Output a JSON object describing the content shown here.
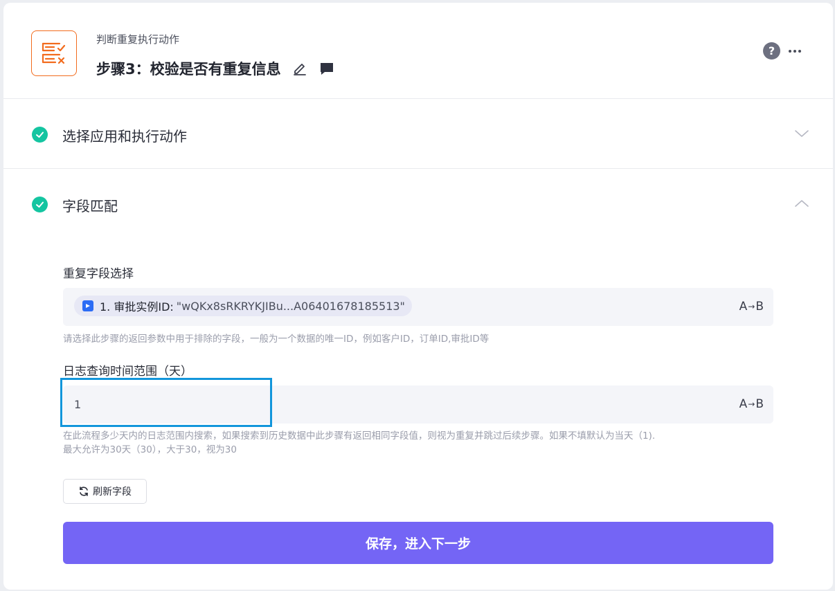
{
  "header": {
    "app_icon": "checklist-x-icon",
    "subtitle": "判断重复执行动作",
    "title": "步骤3：校验是否有重复信息",
    "edit_icon": "pencil-icon",
    "comment_icon": "comment-icon",
    "help_label": "?",
    "more_icon": "more-dots-icon"
  },
  "sections": [
    {
      "label": "选择应用和执行动作",
      "status": "completed",
      "expanded": false
    },
    {
      "label": "字段匹配",
      "status": "completed",
      "expanded": true
    }
  ],
  "fields": {
    "duplicate_field": {
      "label": "重复字段选择",
      "tag_label": "1. 审批实例ID:",
      "tag_value": "\"wQKx8sRKRYKJIBu...A06401678185513\"",
      "hint": "请选择此步骤的返回参数中用于排除的字段，一般为一个数据的唯一ID，例如客户ID，订单ID,审批ID等",
      "mode_label_a": "A",
      "mode_arrow": "→",
      "mode_label_b": "B"
    },
    "log_range": {
      "label": "日志查询时间范围（天）",
      "value": "1",
      "hint_line1": "在此流程多少天内的日志范围内搜索，如果搜索到历史数据中此步骤有返回相同字段值，则视为重复并跳过后续步骤。如果不填默认为当天（1).",
      "hint_line2": "最大允许为30天（30），大于30，视为30",
      "mode_label_a": "A",
      "mode_arrow": "→",
      "mode_label_b": "B"
    }
  },
  "buttons": {
    "refresh": "刷新字段",
    "save": "保存，进入下一步"
  },
  "colors": {
    "accent": "#7465f5",
    "success": "#14c5a1",
    "app_icon": "#f26b1d",
    "focus": "#1296db"
  }
}
